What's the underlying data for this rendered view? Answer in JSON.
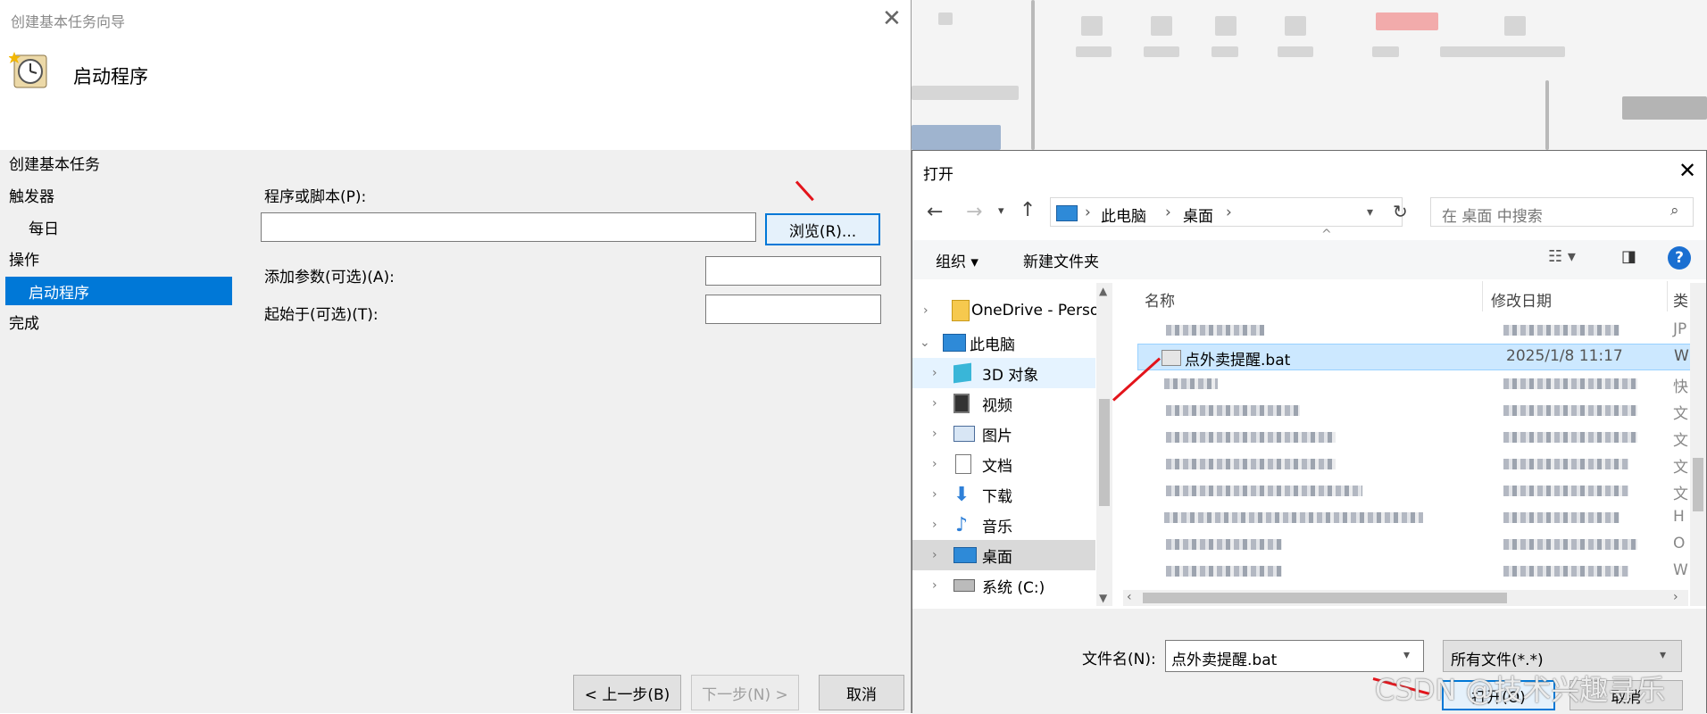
{
  "wizard": {
    "window_title": "创建基本任务向导",
    "header_title": "启动程序",
    "nav": [
      "创建基本任务",
      "触发器",
      "每日",
      "操作",
      "启动程序",
      "完成"
    ],
    "program_label": "程序或脚本(P):",
    "program_value": "",
    "browse_label": "浏览(R)...",
    "args_label": "添加参数(可选)(A):",
    "start_label": "起始于(可选)(T):",
    "back_label": "< 上一步(B)",
    "next_label": "下一步(N) >",
    "cancel_label": "取消"
  },
  "open_dialog": {
    "title": "打开",
    "breadcrumb": [
      "此电脑",
      "桌面"
    ],
    "search_placeholder": "在 桌面 中搜索",
    "organize_label": "组织 ▾",
    "new_folder_label": "新建文件夹",
    "tree": [
      {
        "label": "OneDrive - Perso",
        "icon": "folder-icon"
      },
      {
        "label": "此电脑",
        "icon": "computer-icon"
      },
      {
        "label": "3D 对象",
        "icon": "cube-icon"
      },
      {
        "label": "视频",
        "icon": "video-icon"
      },
      {
        "label": "图片",
        "icon": "picture-icon"
      },
      {
        "label": "文档",
        "icon": "document-icon"
      },
      {
        "label": "下载",
        "icon": "download-icon"
      },
      {
        "label": "音乐",
        "icon": "music-icon"
      },
      {
        "label": "桌面",
        "icon": "desktop-icon"
      },
      {
        "label": "系统 (C:)",
        "icon": "drive-icon"
      }
    ],
    "columns": {
      "name": "名称",
      "modified": "修改日期",
      "type": "类"
    },
    "selected_file": {
      "name": "点外卖提醒.bat",
      "modified": "2025/1/8 11:17",
      "type": "W"
    },
    "type_letters": [
      "JP",
      "W",
      "快",
      "文",
      "文",
      "文",
      "文",
      "H",
      "O",
      "W"
    ],
    "filename_label": "文件名(N):",
    "filename_value": "点外卖提醒.bat",
    "filter_value": "所有文件(*.*)",
    "open_label": "打开(O)",
    "cancel_label": "取消"
  },
  "watermark": "CSDN @技术兴趣寻乐",
  "colors": {
    "accent": "#0078d7",
    "selection": "#cce8ff",
    "annotation": "#e3141b"
  }
}
